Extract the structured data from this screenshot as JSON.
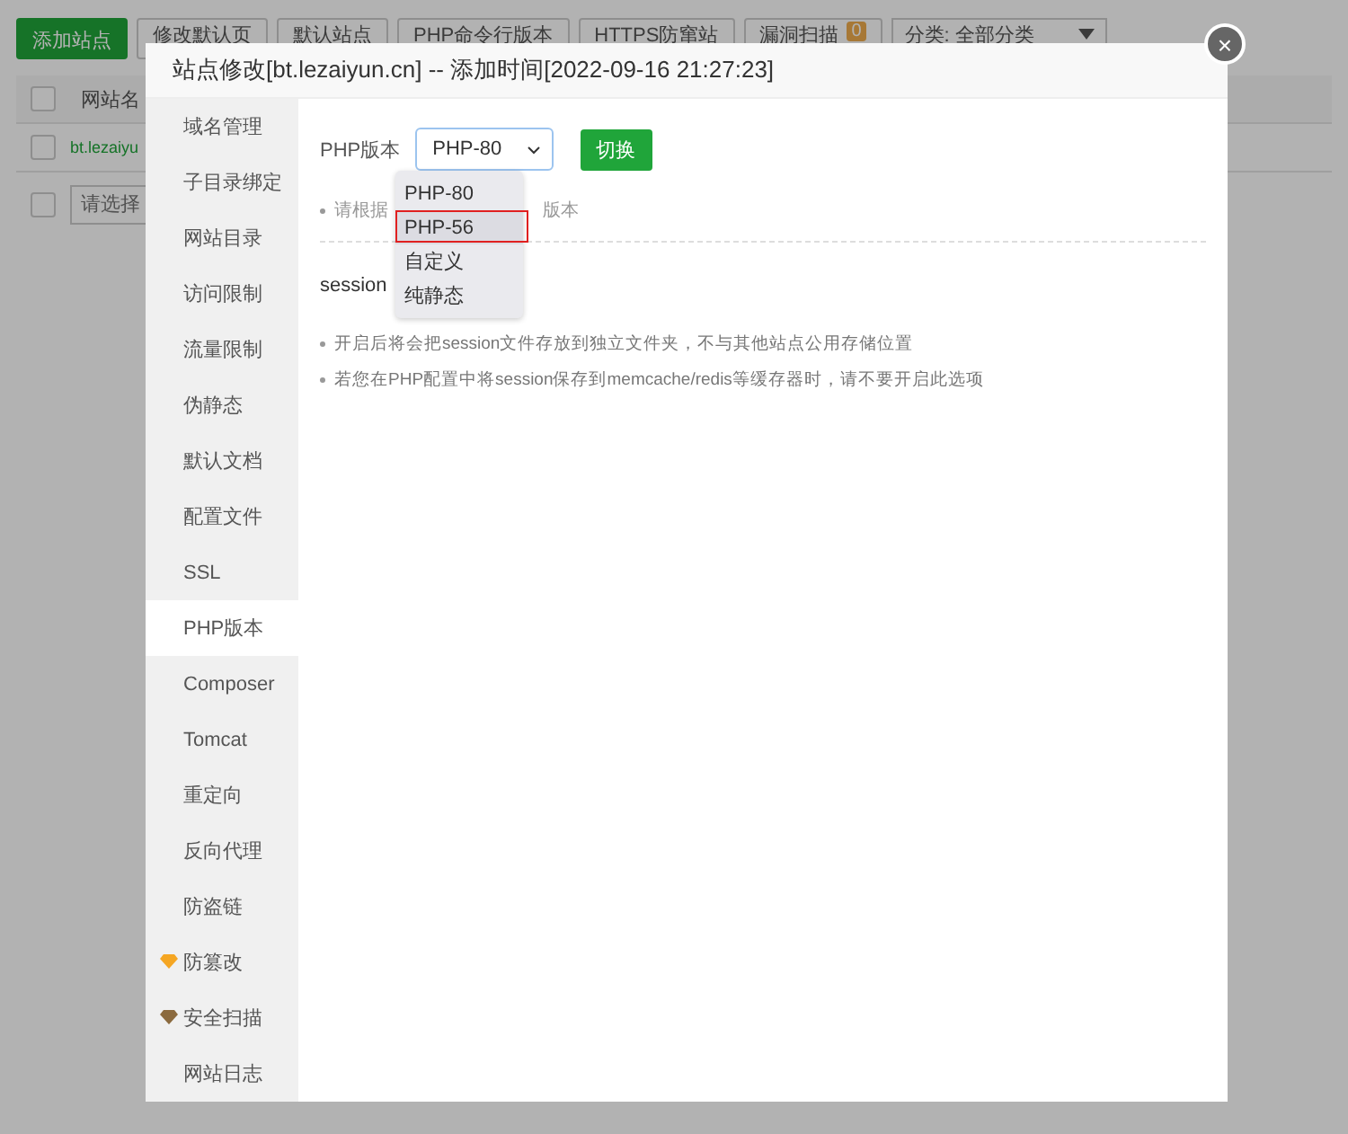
{
  "toolbar": {
    "buttons": [
      {
        "label": "添加站点",
        "kind": "primary"
      },
      {
        "label": "修改默认页",
        "kind": "plain"
      },
      {
        "label": "默认站点",
        "kind": "plain"
      },
      {
        "label": "PHP命令行版本",
        "kind": "plain"
      },
      {
        "label": "HTTPS防窜站",
        "kind": "plain"
      },
      {
        "label": "漏洞扫描",
        "kind": "badge",
        "badge": "0"
      }
    ],
    "category": "分类: 全部分类"
  },
  "table": {
    "header_checked": false,
    "columns": [
      "网站名"
    ],
    "rows": [
      {
        "name": "bt.lezaiyu",
        "checked": false
      }
    ],
    "batch_checked": false,
    "batch_placeholder": "请选择"
  },
  "dialog": {
    "title": "站点修改[bt.lezaiyun.cn] -- 添加时间[2022-09-16 21:27:23]",
    "close": "×",
    "menu": [
      {
        "label": "域名管理",
        "selected": false
      },
      {
        "label": "子目录绑定",
        "selected": false
      },
      {
        "label": "网站目录",
        "selected": false
      },
      {
        "label": "访问限制",
        "selected": false
      },
      {
        "label": "流量限制",
        "selected": false
      },
      {
        "label": "伪静态",
        "selected": false
      },
      {
        "label": "默认文档",
        "selected": false
      },
      {
        "label": "配置文件",
        "selected": false
      },
      {
        "label": "SSL",
        "selected": false
      },
      {
        "label": "PHP版本",
        "selected": true
      },
      {
        "label": "Composer",
        "selected": false
      },
      {
        "label": "Tomcat",
        "selected": false
      },
      {
        "label": "重定向",
        "selected": false
      },
      {
        "label": "反向代理",
        "selected": false
      },
      {
        "label": "防盗链",
        "selected": false
      },
      {
        "label": "防篡改",
        "selected": false,
        "color": "#f5a623"
      },
      {
        "label": "安全扫描",
        "selected": false,
        "color": "#8b6a3e"
      },
      {
        "label": "网站日志",
        "selected": false
      }
    ],
    "php_label": "PHP版本",
    "select_value": "PHP-80",
    "switch_button": "切换",
    "hint_parts": [
      "请根据",
      "版本"
    ],
    "session_label": "session",
    "notes": [
      "开启后将会把session文件存放到独立文件夹，不与其他站点公用存储位置",
      "若您在PHP配置中将session保存到memcache/redis等缓存器时，请不要开启此选项"
    ],
    "options": [
      {
        "label": "PHP-80",
        "selected": false
      },
      {
        "label": "PHP-56",
        "selected": true
      },
      {
        "label": "自定义",
        "selected": false
      },
      {
        "label": "纯静态",
        "selected": false
      }
    ]
  }
}
